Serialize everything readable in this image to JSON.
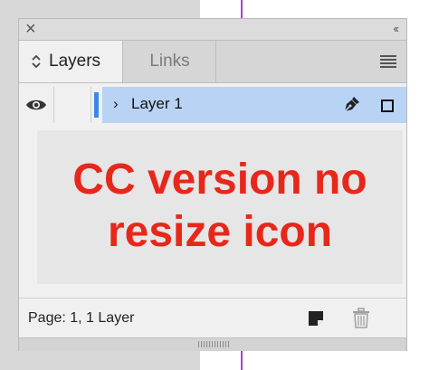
{
  "panel": {
    "close_icon": "close-icon",
    "collapse_icon": "double-chevron-left-icon",
    "collapse_glyph": "‹‹",
    "tabs": [
      {
        "label": "Layers",
        "active": true
      },
      {
        "label": "Links",
        "active": false
      }
    ],
    "menu_icon": "hamburger-menu-icon"
  },
  "layer_row": {
    "name": "Layer 1",
    "expand_glyph": "›",
    "visible": true,
    "selected": true,
    "color": "#3c88e6"
  },
  "annotation": {
    "line1": "CC version no",
    "line2": "resize icon",
    "color": "#e8271b"
  },
  "footer": {
    "status": "Page: 1, 1 Layer"
  },
  "colors": {
    "row_highlight": "#b8d3f4",
    "page_guide": "#b13ad8"
  }
}
